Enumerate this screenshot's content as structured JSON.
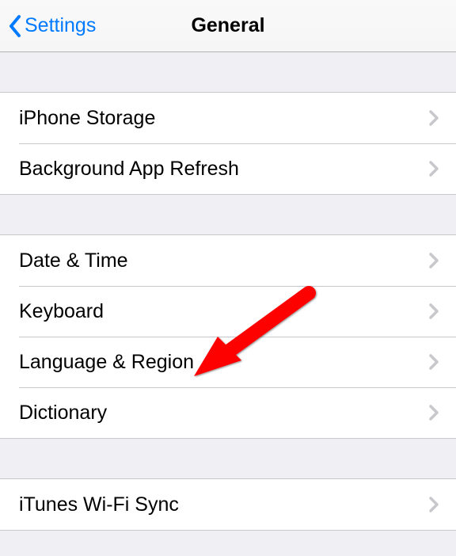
{
  "navbar": {
    "back_label": "Settings",
    "title": "General"
  },
  "groups": [
    {
      "items": [
        {
          "label": "iPhone Storage"
        },
        {
          "label": "Background App Refresh"
        }
      ]
    },
    {
      "items": [
        {
          "label": "Date & Time"
        },
        {
          "label": "Keyboard"
        },
        {
          "label": "Language & Region"
        },
        {
          "label": "Dictionary"
        }
      ]
    },
    {
      "items": [
        {
          "label": "iTunes Wi-Fi Sync"
        }
      ]
    }
  ],
  "annotation": {
    "type": "arrow",
    "color": "#ff0000",
    "points_to": "Language & Region"
  }
}
